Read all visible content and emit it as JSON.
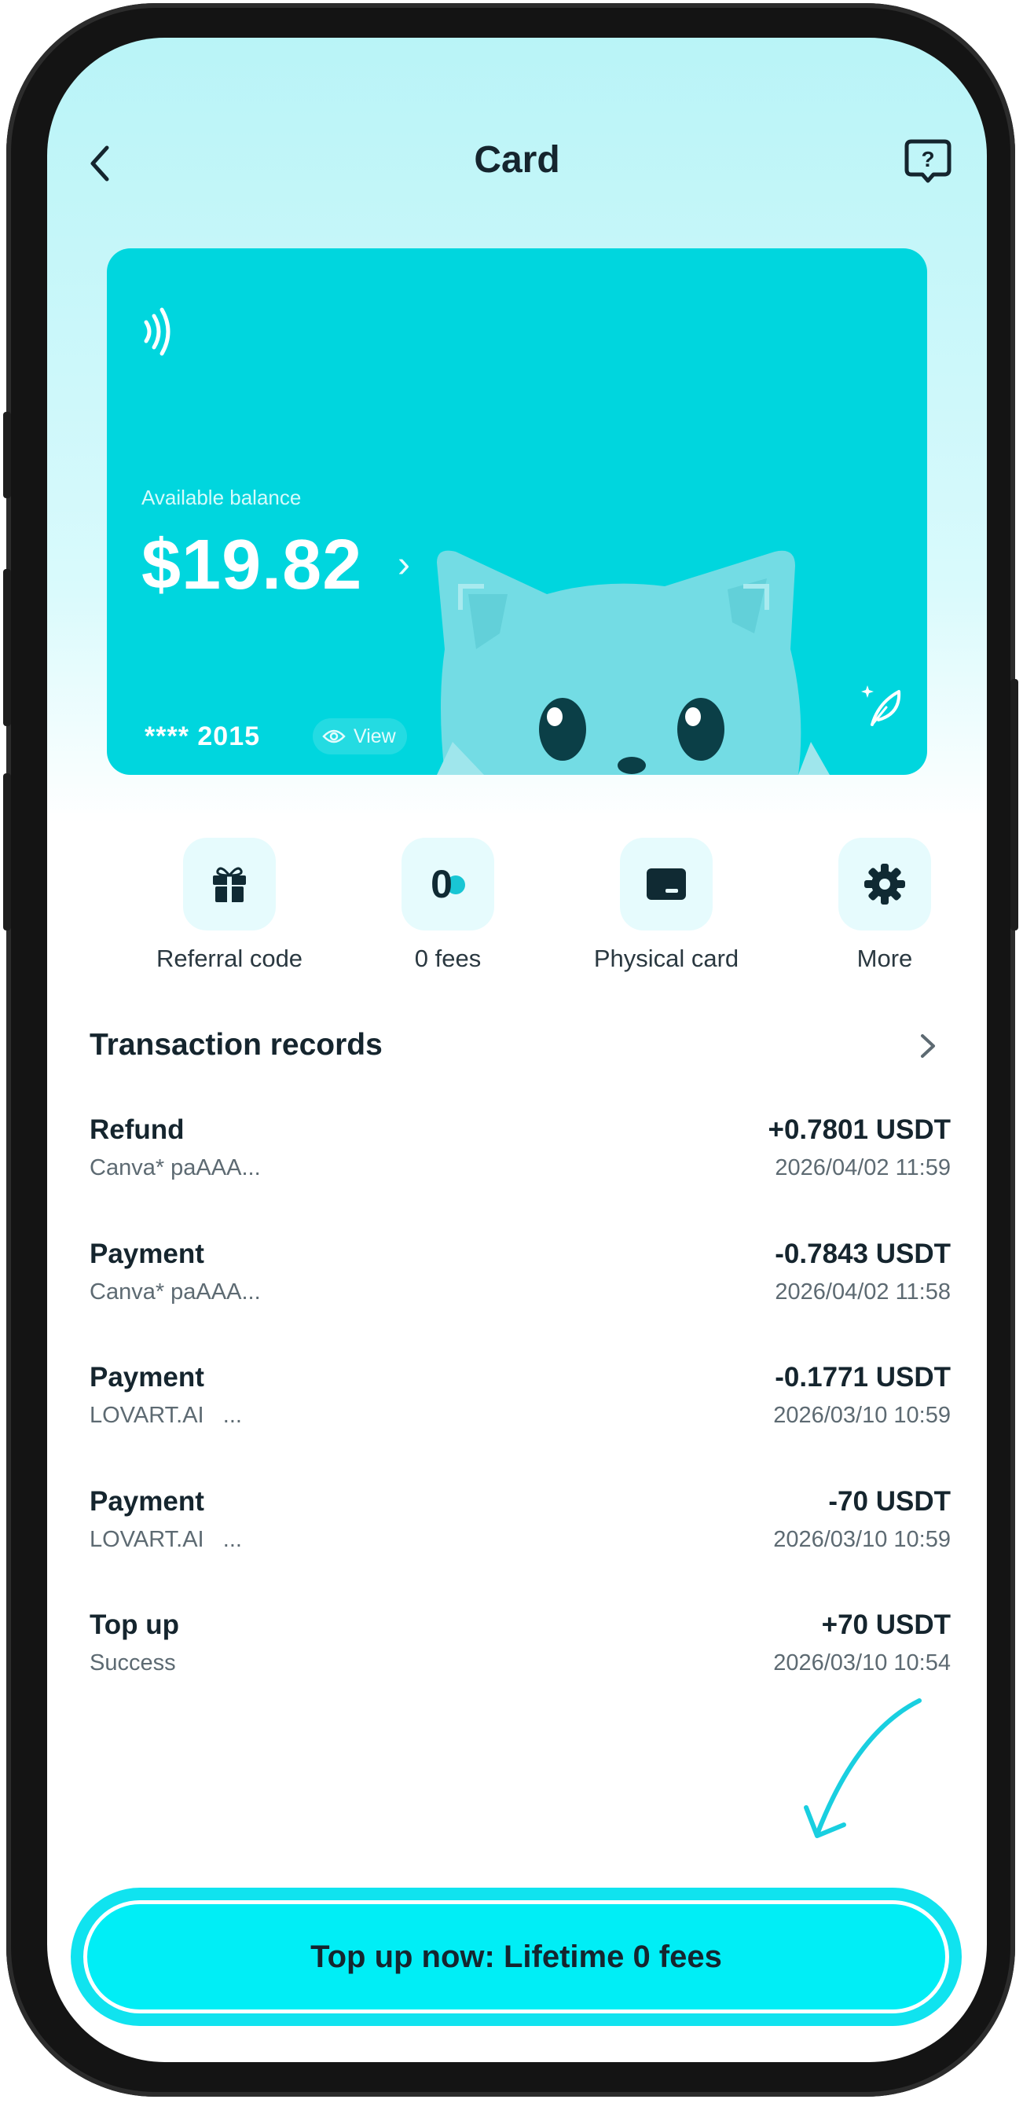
{
  "header": {
    "title": "Card"
  },
  "card": {
    "balance_label": "Available balance",
    "balance": "$19.82",
    "chevron": "›",
    "masked_number": "**** 2015",
    "view_label": "View",
    "background_color": "#00d6de"
  },
  "actions": [
    {
      "label": "Referral code",
      "icon": "gift-icon"
    },
    {
      "label": "0 fees",
      "icon": "zero-fee-icon"
    },
    {
      "label": "Physical card",
      "icon": "card-icon"
    },
    {
      "label": "More",
      "icon": "gear-icon"
    }
  ],
  "transactions": {
    "title": "Transaction records",
    "items": [
      {
        "type": "Refund",
        "desc": "Canva* paAAA...",
        "amount": "+0.7801 USDT",
        "time": "2026/04/02 11:59"
      },
      {
        "type": "Payment",
        "desc": "Canva* paAAA...",
        "amount": "-0.7843 USDT",
        "time": "2026/04/02 11:58"
      },
      {
        "type": "Payment",
        "desc": "LOVART.AI   ...",
        "amount": "-0.1771 USDT",
        "time": "2026/03/10 10:59"
      },
      {
        "type": "Payment",
        "desc": "LOVART.AI   ...",
        "amount": "-70 USDT",
        "time": "2026/03/10 10:59"
      },
      {
        "type": "Top up",
        "desc": "Success",
        "amount": "+70 USDT",
        "time": "2026/03/10 10:54"
      }
    ]
  },
  "cta": {
    "label": "Top up now: Lifetime 0 fees",
    "color": "#00eef6"
  },
  "colors": {
    "accent": "#00d6de",
    "text": "#15252e",
    "muted": "#5d6a72"
  }
}
